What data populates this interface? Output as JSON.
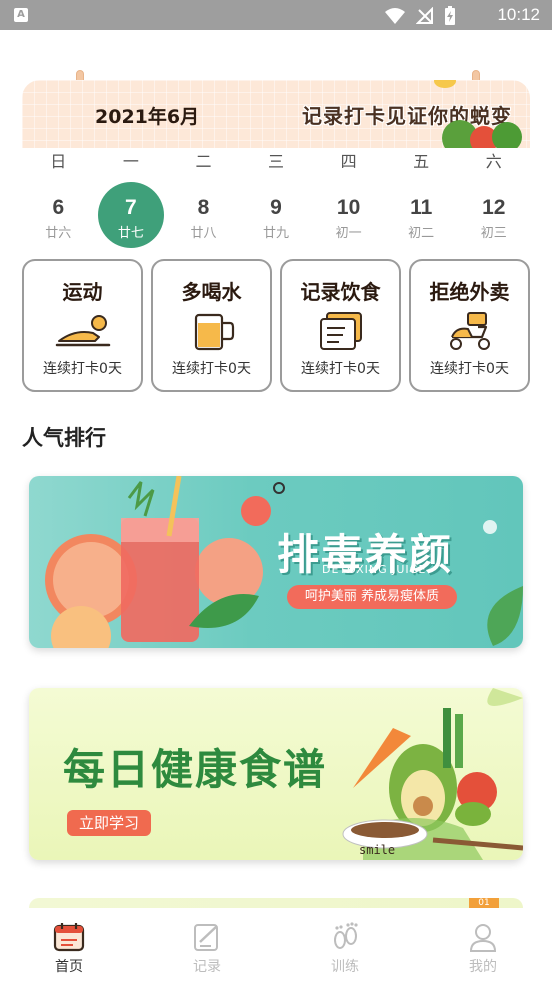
{
  "status_bar": {
    "time": "10:12",
    "app_icon_letter": "A"
  },
  "header": {
    "month_title": "2021年6月",
    "slogan": "记录打卡见证你的蜕变"
  },
  "week": {
    "weekday_labels": [
      "日",
      "一",
      "二",
      "三",
      "四",
      "五",
      "六"
    ],
    "days": [
      {
        "num": "6",
        "lunar": "廿六"
      },
      {
        "num": "7",
        "lunar": "廿七",
        "selected": true
      },
      {
        "num": "8",
        "lunar": "廿八"
      },
      {
        "num": "9",
        "lunar": "廿九"
      },
      {
        "num": "10",
        "lunar": "初一"
      },
      {
        "num": "11",
        "lunar": "初二"
      },
      {
        "num": "12",
        "lunar": "初三"
      }
    ]
  },
  "habits": [
    {
      "title": "运动",
      "status": "连续打卡0天",
      "icon": "exercise-icon"
    },
    {
      "title": "多喝水",
      "status": "连续打卡0天",
      "icon": "water-cup-icon"
    },
    {
      "title": "记录饮食",
      "status": "连续打卡0天",
      "icon": "meal-record-icon"
    },
    {
      "title": "拒绝外卖",
      "status": "连续打卡0天",
      "icon": "delivery-scooter-icon"
    }
  ],
  "section": {
    "title": "人气排行"
  },
  "banners": [
    {
      "title": "排毒养颜",
      "subtitle": "DETOXING JUICE",
      "pill": "呵护美丽 养成易瘦体质"
    },
    {
      "title": "每日健康食谱",
      "button": "立即学习",
      "bowl_text": "smile"
    },
    {
      "badge": "01"
    }
  ],
  "bottom_nav": [
    {
      "label": "首页",
      "icon": "calendar-home-icon",
      "active": true
    },
    {
      "label": "记录",
      "icon": "edit-record-icon"
    },
    {
      "label": "训练",
      "icon": "footprint-train-icon"
    },
    {
      "label": "我的",
      "icon": "user-profile-icon"
    }
  ],
  "colors": {
    "accent_green": "#3fa07a",
    "header_bg": "#fde8d8",
    "banner1_bg": "#6ccbc0",
    "banner2_bg": "#eaf6b8",
    "cta_red": "#f06a4f"
  }
}
